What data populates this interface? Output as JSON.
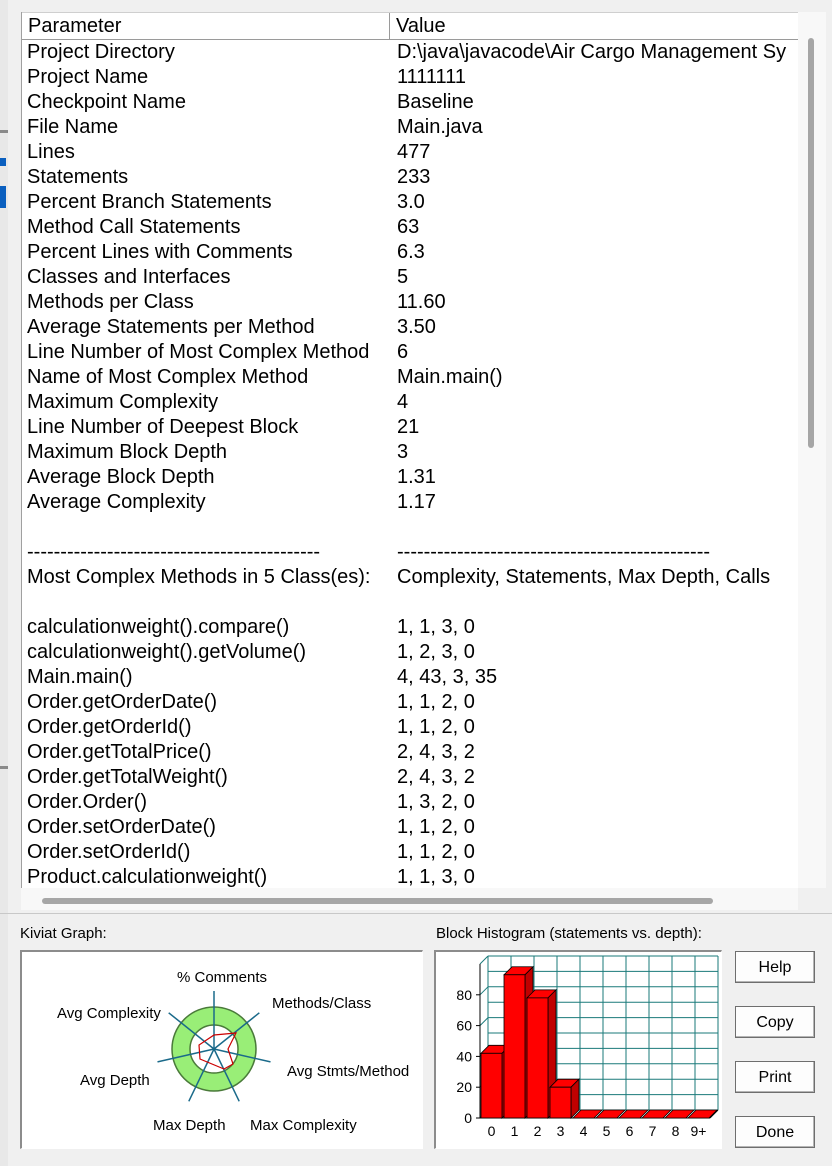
{
  "table": {
    "headers": {
      "parameter": "Parameter",
      "value": "Value"
    },
    "rows": [
      {
        "p": "Project Directory",
        "v": "D:\\java\\javacode\\Air Cargo Management Sy"
      },
      {
        "p": "Project Name",
        "v": "1111111"
      },
      {
        "p": "Checkpoint Name",
        "v": "Baseline"
      },
      {
        "p": "File Name",
        "v": "Main.java"
      },
      {
        "p": "Lines",
        "v": "477"
      },
      {
        "p": "Statements",
        "v": "233"
      },
      {
        "p": "Percent Branch Statements",
        "v": "3.0"
      },
      {
        "p": "Method Call Statements",
        "v": "63"
      },
      {
        "p": "Percent Lines with Comments",
        "v": "6.3"
      },
      {
        "p": "Classes and Interfaces",
        "v": "5"
      },
      {
        "p": "Methods per Class",
        "v": "11.60"
      },
      {
        "p": "Average Statements per Method",
        "v": "3.50"
      },
      {
        "p": "Line Number of Most Complex Method",
        "v": "6"
      },
      {
        "p": "Name of Most Complex Method",
        "v": "Main.main()"
      },
      {
        "p": "Maximum Complexity",
        "v": "4"
      },
      {
        "p": "Line Number of Deepest Block",
        "v": "21"
      },
      {
        "p": "Maximum Block Depth",
        "v": "3"
      },
      {
        "p": "Average Block Depth",
        "v": "1.31"
      },
      {
        "p": "Average Complexity",
        "v": "1.17"
      },
      {
        "p": "",
        "v": ""
      },
      {
        "p": "--------------------------------------------",
        "v": "-----------------------------------------------"
      },
      {
        "p": "Most Complex Methods in 5 Class(es):",
        "v": "Complexity, Statements, Max Depth, Calls"
      },
      {
        "p": "",
        "v": ""
      },
      {
        "p": "calculationweight().compare()",
        "v": "1, 1, 3, 0"
      },
      {
        "p": "calculationweight().getVolume()",
        "v": "1, 2, 3, 0"
      },
      {
        "p": "Main.main()",
        "v": "4, 43, 3, 35"
      },
      {
        "p": "Order.getOrderDate()",
        "v": "1, 1, 2, 0"
      },
      {
        "p": "Order.getOrderId()",
        "v": "1, 1, 2, 0"
      },
      {
        "p": "Order.getTotalPrice()",
        "v": "2, 4, 3, 2"
      },
      {
        "p": "Order.getTotalWeight()",
        "v": "2, 4, 3, 2"
      },
      {
        "p": "Order.Order()",
        "v": "1, 3, 2, 0"
      },
      {
        "p": "Order.setOrderDate()",
        "v": "1, 1, 2, 0"
      },
      {
        "p": "Order.setOrderId()",
        "v": "1, 1, 2, 0"
      },
      {
        "p": "Product.calculationweight()",
        "v": "1, 1, 3, 0"
      }
    ]
  },
  "kiviat": {
    "title": "Kiviat Graph:",
    "axes": [
      "% Comments",
      "Methods/Class",
      "Avg Stmts/Method",
      "Max Complexity",
      "Max Depth",
      "Avg Depth",
      "Avg Complexity"
    ],
    "colors": {
      "fill": "#99ee77",
      "ring": "#4a7a3a",
      "axis": "#1a6a8a",
      "plot": "#cc0000"
    }
  },
  "histogram": {
    "title": "Block Histogram (statements vs. depth):",
    "chart_data": {
      "type": "bar",
      "categories": [
        "0",
        "1",
        "2",
        "3",
        "4",
        "5",
        "6",
        "7",
        "8",
        "9+"
      ],
      "values": [
        42,
        93,
        78,
        20,
        0,
        0,
        0,
        0,
        0,
        0
      ],
      "yticks": [
        "0",
        "20",
        "40",
        "60",
        "80"
      ],
      "ylim": [
        0,
        100
      ],
      "bar_color": "#ff0000",
      "grid_color": "#1a7a7a"
    }
  },
  "buttons": {
    "help": "Help",
    "copy": "Copy",
    "print": "Print",
    "done": "Done"
  }
}
